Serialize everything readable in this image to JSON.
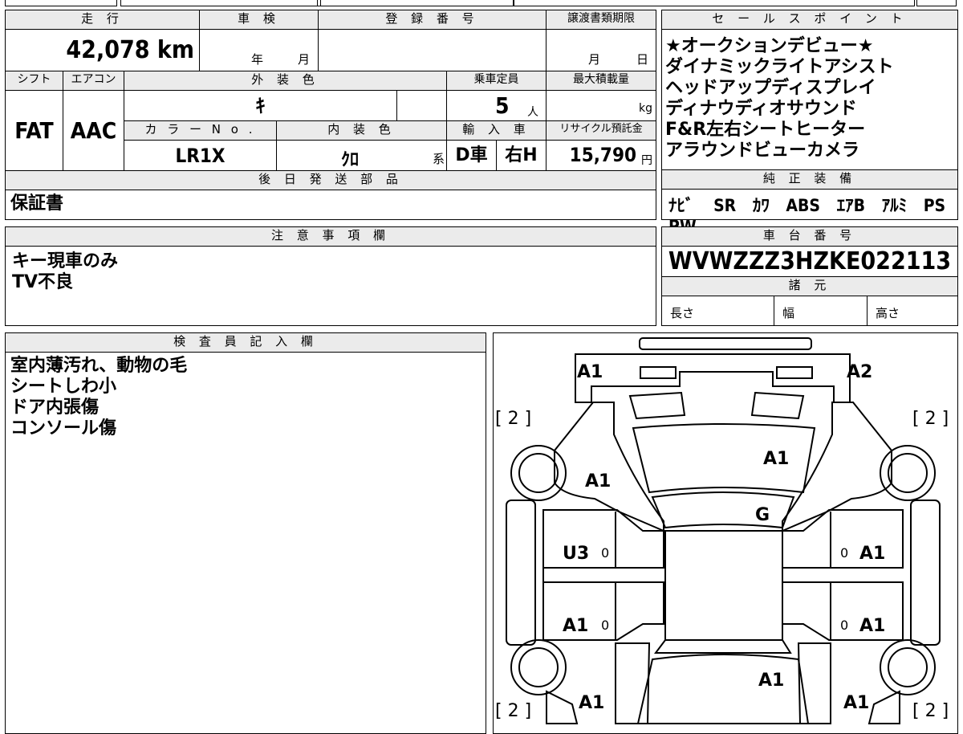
{
  "top_table": {
    "mileage_header": "走 行",
    "mileage_value": "42,078 km",
    "inspection_header": "車 検",
    "inspection_year_unit": "年",
    "inspection_month_unit": "月",
    "registration_header": "登 録 番 号",
    "transfer_header": "譲渡書類期限",
    "transfer_month_unit": "月",
    "transfer_day_unit": "日",
    "shift_header": "シフト",
    "shift_value": "FAT",
    "ac_header": "エアコン",
    "ac_value": "AAC",
    "exterior_header": "外 装 色",
    "exterior_value": "ｷ",
    "capacity_header": "乗車定員",
    "capacity_value": "5",
    "capacity_unit": "人",
    "maxload_header": "最大積載量",
    "maxload_unit": "kg",
    "colorno_header": "カ ラ ー N o .",
    "colorno_value": "LR1X",
    "interior_header": "内 装 色",
    "interior_value": "ｸﾛ",
    "interior_suffix": "系",
    "import_header": "輸 入 車",
    "import_value1": "D車",
    "import_value2": "右H",
    "recycle_header": "リサイクル預託金",
    "recycle_value": "15,790",
    "recycle_unit": "円",
    "parts_header": "後 日 発 送 部 品",
    "parts_value": "保証書"
  },
  "sales_points": {
    "header": "セ ー ル ス ポ イ ン ト",
    "items": [
      "★オークションデビュー★",
      "ダイナミックライトアシスト",
      "ヘッドアップディスプレイ",
      "ディナウディオサウンド",
      "F&R左右シートヒーター",
      "アラウンドビューカメラ"
    ]
  },
  "equipment": {
    "header": "純 正 装 備",
    "items": [
      "ﾅﾋﾞ",
      "SR",
      "ｶﾜ",
      "ABS",
      "ｴｱB",
      "ｱﾙﾐ",
      "PS",
      "PW"
    ]
  },
  "notes": {
    "header": "注 意 事 項 欄",
    "lines": [
      "キー現車のみ",
      "TV不良"
    ]
  },
  "chassis": {
    "header": "車 台 番 号",
    "value": "WVWZZZ3HZKE022113"
  },
  "specs": {
    "header": "諸 元",
    "length_label": "長さ",
    "width_label": "幅",
    "height_label": "高さ"
  },
  "inspector": {
    "header": "検 査 員 記 入 欄",
    "lines": [
      "室内薄汚れ、動物の毛",
      "シートしわ小",
      "ドア内張傷",
      "コンソール傷"
    ]
  },
  "diagram": {
    "marks": {
      "front_left": "A1",
      "front_right": "A2",
      "fender_left": "A1",
      "hood": "A1",
      "windshield": "G",
      "door_fl": "U3",
      "door_fr": "A1",
      "door_rl": "A1",
      "door_rr": "A1",
      "roof_rear": "A1",
      "rear_left": "A1",
      "rear_right": "A1"
    },
    "tyre_tl": "2",
    "tyre_tr": "2",
    "tyre_bl": "2",
    "tyre_br": "2",
    "handle_fl": "0",
    "handle_fr": "0",
    "handle_rl": "0",
    "handle_rr": "0"
  }
}
